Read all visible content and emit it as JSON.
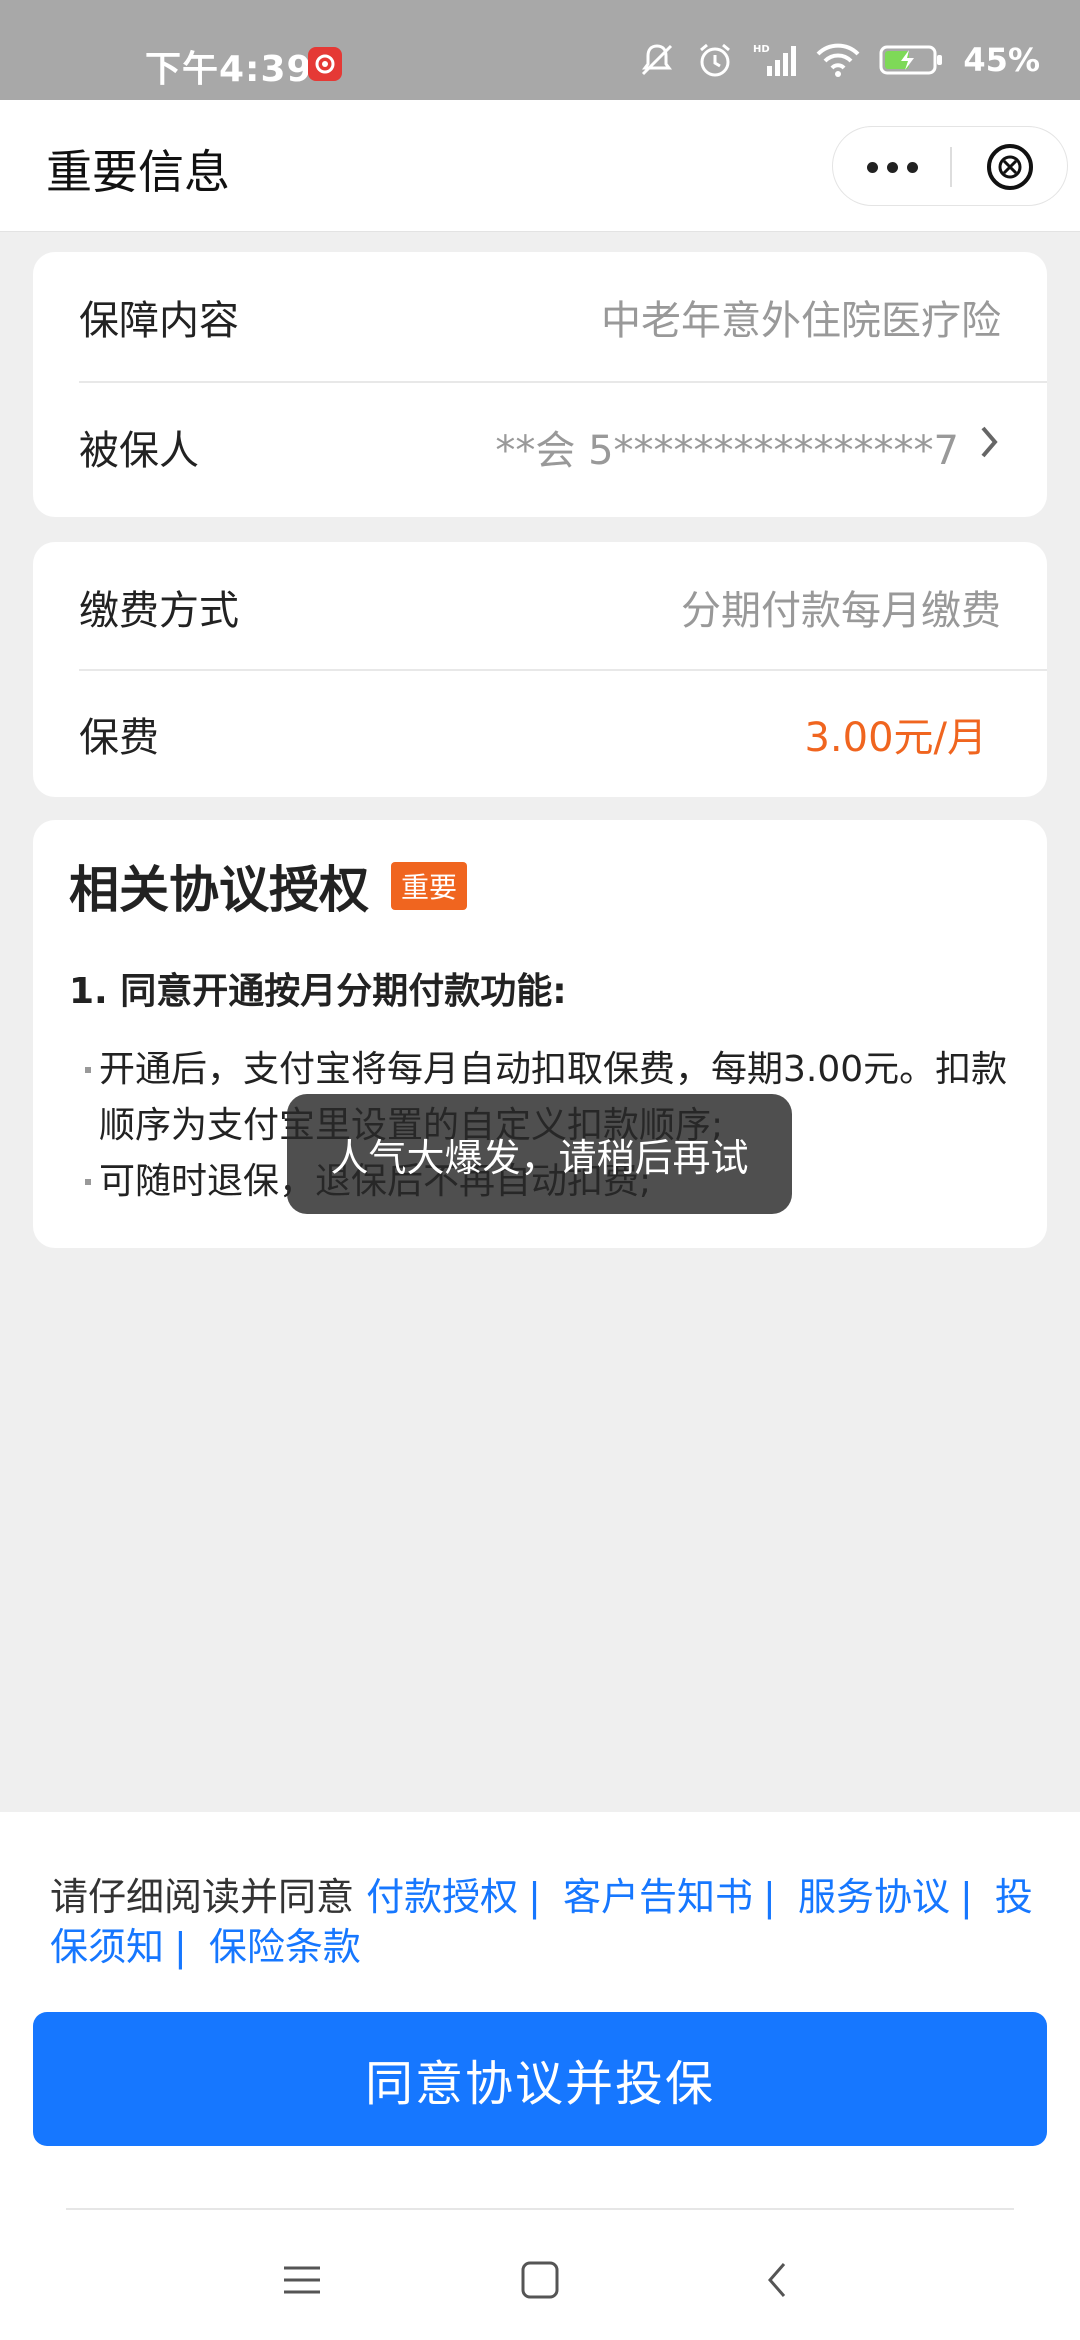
{
  "status_bar": {
    "time": "下午4:39",
    "battery": "45%",
    "icons": [
      "mute-icon",
      "alarm-icon",
      "hd-signal-icon",
      "wifi-icon",
      "battery-charging-icon"
    ]
  },
  "title_bar": {
    "title": "重要信息",
    "more_icon": "more-icon",
    "close_icon": "close-circle-icon"
  },
  "coverage_card": {
    "rows": [
      {
        "label": "保障内容",
        "value": "中老年意外住院医疗险"
      },
      {
        "label": "被保人",
        "value": "**会 5****************7"
      }
    ]
  },
  "payment_card": {
    "rows": [
      {
        "label": "缴费方式",
        "value": "分期付款每月缴费"
      },
      {
        "label": "保费",
        "value": "3.00元/月"
      }
    ]
  },
  "agreement_card": {
    "title": "相关协议授权",
    "badge": "重要",
    "clause_title": "1. 同意开通按月分期付款功能:",
    "bullets": [
      "开通后，支付宝将每月自动扣取保费，每期3.00元。扣款顺序为支付宝里设置的自定义扣款顺序;",
      "可随时退保，退保后不再自动扣费;"
    ]
  },
  "toast": {
    "text": "人气大爆发，请稍后再试"
  },
  "bottom": {
    "prefix": "请仔细阅读并同意",
    "links": [
      "付款授权",
      "客户告知书",
      "服务协议",
      "投保须知",
      "保险条款"
    ],
    "cta": "同意协议并投保"
  },
  "colors": {
    "accent_blue": "#1677ff",
    "accent_orange": "#f0651f",
    "background": "#efefef"
  }
}
